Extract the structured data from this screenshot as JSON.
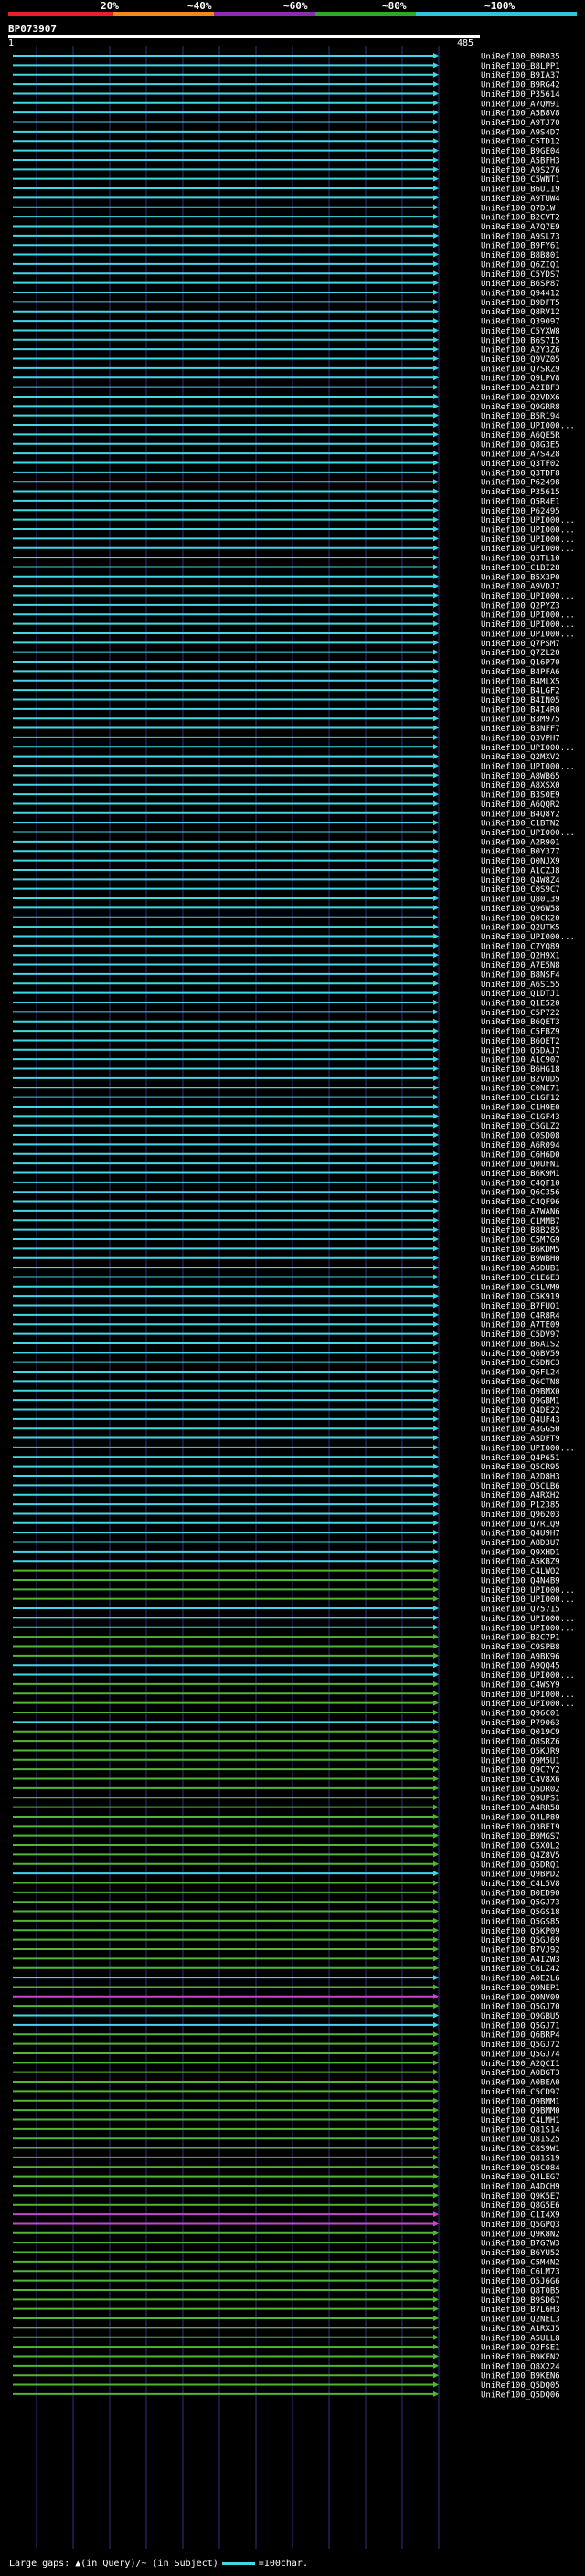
{
  "scale": {
    "labels": [
      "20%",
      "~40%",
      "~60%",
      "~80%",
      "~100%"
    ],
    "colors": [
      "#e8202a",
      "#f08a1a",
      "#8b2db3",
      "#2da82b",
      "#2dc7d8"
    ]
  },
  "query": {
    "name": "BP073907",
    "start": "1",
    "end": "485"
  },
  "colors": {
    "identity_high": "#3fd9e6",
    "identity_mid": "#4fb833",
    "identity_low": "#cc44cc",
    "grid": "#303080"
  },
  "legend": {
    "text": "Large gaps: ▲(in Query)/~ (in Subject)",
    "line_label": "=100char."
  },
  "hits": [
    {
      "label": "UniRef100_B9R035",
      "color": "cyan"
    },
    {
      "label": "UniRef100_B8LPP1",
      "color": "cyan"
    },
    {
      "label": "UniRef100_B9IA37",
      "color": "cyan"
    },
    {
      "label": "UniRef100_B9RG42",
      "color": "cyan"
    },
    {
      "label": "UniRef100_P35614",
      "color": "cyan"
    },
    {
      "label": "UniRef100_A7QM91",
      "color": "cyan"
    },
    {
      "label": "UniRef100_A5B8V8",
      "color": "cyan"
    },
    {
      "label": "UniRef100_A9TJ70",
      "color": "cyan"
    },
    {
      "label": "UniRef100_A9S4D7",
      "color": "cyan"
    },
    {
      "label": "UniRef100_C5TD12",
      "color": "cyan"
    },
    {
      "label": "UniRef100_B9GE04",
      "color": "cyan"
    },
    {
      "label": "UniRef100_A5BFH3",
      "color": "cyan"
    },
    {
      "label": "UniRef100_A9S276",
      "color": "cyan"
    },
    {
      "label": "UniRef100_C5WNT1",
      "color": "cyan"
    },
    {
      "label": "UniRef100_B6U119",
      "color": "cyan"
    },
    {
      "label": "UniRef100_A9TUW4",
      "color": "cyan"
    },
    {
      "label": "UniRef100_Q7D1W",
      "color": "cyan"
    },
    {
      "label": "UniRef100_B2CVT2",
      "color": "cyan"
    },
    {
      "label": "UniRef100_A7Q7E9",
      "color": "cyan"
    },
    {
      "label": "UniRef100_A9SL73",
      "color": "cyan"
    },
    {
      "label": "UniRef100_B9FY61",
      "color": "cyan"
    },
    {
      "label": "UniRef100_B8B801",
      "color": "cyan"
    },
    {
      "label": "UniRef100_Q6ZIQ1",
      "color": "cyan"
    },
    {
      "label": "UniRef100_C5YDS7",
      "color": "cyan"
    },
    {
      "label": "UniRef100_B6SP87",
      "color": "cyan"
    },
    {
      "label": "UniRef100_Q94412",
      "color": "cyan"
    },
    {
      "label": "UniRef100_B9DFT5",
      "color": "cyan"
    },
    {
      "label": "UniRef100_Q8RV12",
      "color": "cyan"
    },
    {
      "label": "UniRef100_Q39097",
      "color": "cyan"
    },
    {
      "label": "UniRef100_C5YXW8",
      "color": "cyan"
    },
    {
      "label": "UniRef100_B6S7I5",
      "color": "cyan"
    },
    {
      "label": "UniRef100_A2Y3Z6",
      "color": "cyan"
    },
    {
      "label": "UniRef100_Q9VZ05",
      "color": "cyan"
    },
    {
      "label": "UniRef100_Q7SRZ9",
      "color": "cyan"
    },
    {
      "label": "UniRef100_Q9LPV8",
      "color": "cyan"
    },
    {
      "label": "UniRef100_A2IBF3",
      "color": "cyan"
    },
    {
      "label": "UniRef100_Q2VDX6",
      "color": "cyan"
    },
    {
      "label": "UniRef100_Q9GRR8",
      "color": "cyan"
    },
    {
      "label": "UniRef100_B5R194",
      "color": "cyan"
    },
    {
      "label": "UniRef100_UPI000...",
      "color": "cyan"
    },
    {
      "label": "UniRef100_A6QE5R",
      "color": "cyan"
    },
    {
      "label": "UniRef100_Q8G3E5",
      "color": "cyan"
    },
    {
      "label": "UniRef100_A7S428",
      "color": "cyan"
    },
    {
      "label": "UniRef100_Q3TF02",
      "color": "cyan"
    },
    {
      "label": "UniRef100_Q3TDF8",
      "color": "cyan"
    },
    {
      "label": "UniRef100_P62498",
      "color": "cyan"
    },
    {
      "label": "UniRef100_P35615",
      "color": "cyan"
    },
    {
      "label": "UniRef100_Q5R4E1",
      "color": "cyan"
    },
    {
      "label": "UniRef100_P62495",
      "color": "cyan"
    },
    {
      "label": "UniRef100_UPI000...",
      "color": "cyan"
    },
    {
      "label": "UniRef100_UPI000...",
      "color": "cyan"
    },
    {
      "label": "UniRef100_UPI000...",
      "color": "cyan"
    },
    {
      "label": "UniRef100_UPI000...",
      "color": "cyan"
    },
    {
      "label": "UniRef100_Q3TL10",
      "color": "cyan"
    },
    {
      "label": "UniRef100_C1BI28",
      "color": "cyan"
    },
    {
      "label": "UniRef100_B5X3P0",
      "color": "cyan"
    },
    {
      "label": "UniRef100_A9VDJ7",
      "color": "cyan"
    },
    {
      "label": "UniRef100_UPI000...",
      "color": "cyan"
    },
    {
      "label": "UniRef100_Q2PYZ3",
      "color": "cyan"
    },
    {
      "label": "UniRef100_UPI000...",
      "color": "cyan"
    },
    {
      "label": "UniRef100_UPI000...",
      "color": "cyan"
    },
    {
      "label": "UniRef100_UPI000...",
      "color": "cyan"
    },
    {
      "label": "UniRef100_Q7PSM7",
      "color": "cyan"
    },
    {
      "label": "UniRef100_Q7ZL20",
      "color": "cyan"
    },
    {
      "label": "UniRef100_Q16P70",
      "color": "cyan"
    },
    {
      "label": "UniRef100_B4PFA6",
      "color": "cyan"
    },
    {
      "label": "UniRef100_B4MLX5",
      "color": "cyan"
    },
    {
      "label": "UniRef100_B4LGF2",
      "color": "cyan"
    },
    {
      "label": "UniRef100_B4IN05",
      "color": "cyan"
    },
    {
      "label": "UniRef100_B4I4R0",
      "color": "cyan"
    },
    {
      "label": "UniRef100_B3M975",
      "color": "cyan"
    },
    {
      "label": "UniRef100_B3NFF7",
      "color": "cyan"
    },
    {
      "label": "UniRef100_Q3VPH7",
      "color": "cyan"
    },
    {
      "label": "UniRef100_UPI000...",
      "color": "cyan"
    },
    {
      "label": "UniRef100_Q2MXV2",
      "color": "cyan"
    },
    {
      "label": "UniRef100_UPI000...",
      "color": "cyan"
    },
    {
      "label": "UniRef100_A8WB65",
      "color": "cyan"
    },
    {
      "label": "UniRef100_A8XSX0",
      "color": "cyan"
    },
    {
      "label": "UniRef100_B3S0E9",
      "color": "cyan"
    },
    {
      "label": "UniRef100_A6QQR2",
      "color": "cyan"
    },
    {
      "label": "UniRef100_B4Q8Y2",
      "color": "cyan"
    },
    {
      "label": "UniRef100_C1BTN2",
      "color": "cyan"
    },
    {
      "label": "UniRef100_UPI000...",
      "color": "cyan"
    },
    {
      "label": "UniRef100_A2R901",
      "color": "cyan"
    },
    {
      "label": "UniRef100_B0Y377",
      "color": "cyan"
    },
    {
      "label": "UniRef100_Q0NJX9",
      "color": "cyan"
    },
    {
      "label": "UniRef100_A1CZJ8",
      "color": "cyan"
    },
    {
      "label": "UniRef100_Q4W8Z4",
      "color": "cyan"
    },
    {
      "label": "UniRef100_C0S9C7",
      "color": "cyan"
    },
    {
      "label": "UniRef100_Q80139",
      "color": "cyan"
    },
    {
      "label": "UniRef100_Q96W58",
      "color": "cyan"
    },
    {
      "label": "UniRef100_Q0CK20",
      "color": "cyan"
    },
    {
      "label": "UniRef100_Q2UTK5",
      "color": "cyan"
    },
    {
      "label": "UniRef100_UPI000...",
      "color": "cyan"
    },
    {
      "label": "UniRef100_C7YQ89",
      "color": "cyan"
    },
    {
      "label": "UniRef100_Q2H9X1",
      "color": "cyan"
    },
    {
      "label": "UniRef100_A7E5N8",
      "color": "cyan"
    },
    {
      "label": "UniRef100_B8NSF4",
      "color": "cyan"
    },
    {
      "label": "UniRef100_A6S155",
      "color": "cyan"
    },
    {
      "label": "UniRef100_Q1DTJ1",
      "color": "cyan"
    },
    {
      "label": "UniRef100_Q1E520",
      "color": "cyan"
    },
    {
      "label": "UniRef100_C5P722",
      "color": "cyan"
    },
    {
      "label": "UniRef100_B6QET3",
      "color": "cyan"
    },
    {
      "label": "UniRef100_C5FBZ9",
      "color": "cyan"
    },
    {
      "label": "UniRef100_B6QET2",
      "color": "cyan"
    },
    {
      "label": "UniRef100_Q5DAJ7",
      "color": "cyan"
    },
    {
      "label": "UniRef100_A1C907",
      "color": "cyan"
    },
    {
      "label": "UniRef100_B6HG18",
      "color": "cyan"
    },
    {
      "label": "UniRef100_B2VUD5",
      "color": "cyan"
    },
    {
      "label": "UniRef100_C0NE71",
      "color": "cyan"
    },
    {
      "label": "UniRef100_C1GF12",
      "color": "cyan"
    },
    {
      "label": "UniRef100_C1H9E0",
      "color": "cyan"
    },
    {
      "label": "UniRef100_C1GF43",
      "color": "cyan"
    },
    {
      "label": "UniRef100_C5GLZ2",
      "color": "cyan"
    },
    {
      "label": "UniRef100_C0SD08",
      "color": "cyan"
    },
    {
      "label": "UniRef100_A6R094",
      "color": "cyan"
    },
    {
      "label": "UniRef100_C6H6D0",
      "color": "cyan"
    },
    {
      "label": "UniRef100_Q0UFN1",
      "color": "cyan"
    },
    {
      "label": "UniRef100_B6K9M1",
      "color": "cyan"
    },
    {
      "label": "UniRef100_C4QF10",
      "color": "cyan"
    },
    {
      "label": "UniRef100_Q6C356",
      "color": "cyan"
    },
    {
      "label": "UniRef100_C4QF96",
      "color": "cyan"
    },
    {
      "label": "UniRef100_A7WAN6",
      "color": "cyan"
    },
    {
      "label": "UniRef100_C1MMB7",
      "color": "cyan"
    },
    {
      "label": "UniRef100_B8B285",
      "color": "cyan"
    },
    {
      "label": "UniRef100_C5M7G9",
      "color": "cyan"
    },
    {
      "label": "UniRef100_B6KDM5",
      "color": "cyan"
    },
    {
      "label": "UniRef100_B9WBH0",
      "color": "cyan"
    },
    {
      "label": "UniRef100_A5DUB1",
      "color": "cyan"
    },
    {
      "label": "UniRef100_C1E6E3",
      "color": "cyan"
    },
    {
      "label": "UniRef100_C5LVM9",
      "color": "cyan"
    },
    {
      "label": "UniRef100_C5K919",
      "color": "cyan"
    },
    {
      "label": "UniRef100_B7FUO1",
      "color": "cyan"
    },
    {
      "label": "UniRef100_C4R8R4",
      "color": "cyan"
    },
    {
      "label": "UniRef100_A7TE09",
      "color": "cyan"
    },
    {
      "label": "UniRef100_C5DV97",
      "color": "cyan"
    },
    {
      "label": "UniRef100_B6AIS2",
      "color": "cyan"
    },
    {
      "label": "UniRef100_Q6BV59",
      "color": "cyan"
    },
    {
      "label": "UniRef100_C5DNC3",
      "color": "cyan"
    },
    {
      "label": "UniRef100_Q6FL24",
      "color": "cyan"
    },
    {
      "label": "UniRef100_Q6CTN8",
      "color": "cyan"
    },
    {
      "label": "UniRef100_Q9BMX0",
      "color": "cyan"
    },
    {
      "label": "UniRef100_Q9GBM1",
      "color": "cyan"
    },
    {
      "label": "UniRef100_Q4DE22",
      "color": "cyan"
    },
    {
      "label": "UniRef100_Q4UF43",
      "color": "cyan"
    },
    {
      "label": "UniRef100_A3GG50",
      "color": "cyan"
    },
    {
      "label": "UniRef100_A5DFT9",
      "color": "cyan"
    },
    {
      "label": "UniRef100_UPI000...",
      "color": "cyan"
    },
    {
      "label": "UniRef100_Q4P651",
      "color": "cyan"
    },
    {
      "label": "UniRef100_Q5CR95",
      "color": "cyan"
    },
    {
      "label": "UniRef100_A2D8H3",
      "color": "cyan"
    },
    {
      "label": "UniRef100_Q5CLB6",
      "color": "cyan"
    },
    {
      "label": "UniRef100_A4RXH2",
      "color": "cyan"
    },
    {
      "label": "UniRef100_P12385",
      "color": "cyan"
    },
    {
      "label": "UniRef100_Q96203",
      "color": "cyan"
    },
    {
      "label": "UniRef100_Q7R1Q9",
      "color": "cyan"
    },
    {
      "label": "UniRef100_Q4U9H7",
      "color": "cyan"
    },
    {
      "label": "UniRef100_A8D3U7",
      "color": "cyan"
    },
    {
      "label": "UniRef100_Q9XHD1",
      "color": "cyan"
    },
    {
      "label": "UniRef100_A5KBZ9",
      "color": "cyan"
    },
    {
      "label": "UniRef100_C4LWQ2",
      "color": "green"
    },
    {
      "label": "UniRef100_Q4N4B9",
      "color": "green"
    },
    {
      "label": "UniRef100_UPI000...",
      "color": "green"
    },
    {
      "label": "UniRef100_UPI000...",
      "color": "green"
    },
    {
      "label": "UniRef100_Q75715",
      "color": "cyan"
    },
    {
      "label": "UniRef100_UPI000...",
      "color": "cyan"
    },
    {
      "label": "UniRef100_UPI000...",
      "color": "cyan"
    },
    {
      "label": "UniRef100_B2C7P1",
      "color": "green"
    },
    {
      "label": "UniRef100_C9SPB8",
      "color": "green"
    },
    {
      "label": "UniRef100_A9BK96",
      "color": "green"
    },
    {
      "label": "UniRef100_A9QQ45",
      "color": "cyan"
    },
    {
      "label": "UniRef100_UPI000...",
      "color": "cyan"
    },
    {
      "label": "UniRef100_C4WSY9",
      "color": "green"
    },
    {
      "label": "UniRef100_UPI000...",
      "color": "green"
    },
    {
      "label": "UniRef100_UPI000...",
      "color": "green"
    },
    {
      "label": "UniRef100_Q96C01",
      "color": "green"
    },
    {
      "label": "UniRef100_P79063",
      "color": "cyan"
    },
    {
      "label": "UniRef100_Q019C9",
      "color": "green"
    },
    {
      "label": "UniRef100_Q8SRZ6",
      "color": "green"
    },
    {
      "label": "UniRef100_Q5KJR9",
      "color": "green"
    },
    {
      "label": "UniRef100_Q9M5U1",
      "color": "green"
    },
    {
      "label": "UniRef100_Q9C7Y2",
      "color": "green"
    },
    {
      "label": "UniRef100_C4V8X6",
      "color": "green"
    },
    {
      "label": "UniRef100_Q5DR02",
      "color": "green"
    },
    {
      "label": "UniRef100_Q9UPS1",
      "color": "green"
    },
    {
      "label": "UniRef100_A4RR58",
      "color": "green"
    },
    {
      "label": "UniRef100_Q4LP89",
      "color": "green"
    },
    {
      "label": "UniRef100_Q3BEI9",
      "color": "green"
    },
    {
      "label": "UniRef100_B9MGS7",
      "color": "green"
    },
    {
      "label": "UniRef100_C5X0L2",
      "color": "green"
    },
    {
      "label": "UniRef100_Q4Z8V5",
      "color": "green"
    },
    {
      "label": "UniRef100_Q5DRQ1",
      "color": "green"
    },
    {
      "label": "UniRef100_Q9BPD2",
      "color": "cyan"
    },
    {
      "label": "UniRef100_C4L5V8",
      "color": "green"
    },
    {
      "label": "UniRef100_B0ED90",
      "color": "green"
    },
    {
      "label": "UniRef100_Q5GJ73",
      "color": "green"
    },
    {
      "label": "UniRef100_Q5GS18",
      "color": "green"
    },
    {
      "label": "UniRef100_Q5GS85",
      "color": "green"
    },
    {
      "label": "UniRef100_Q5KP09",
      "color": "green"
    },
    {
      "label": "UniRef100_Q5GJ69",
      "color": "green"
    },
    {
      "label": "UniRef100_B7VJ92",
      "color": "green"
    },
    {
      "label": "UniRef100_A4IZW3",
      "color": "green"
    },
    {
      "label": "UniRef100_C6LZ42",
      "color": "green"
    },
    {
      "label": "UniRef100_A0E2L6",
      "color": "cyan"
    },
    {
      "label": "UniRef100_Q9NEP1",
      "color": "green"
    },
    {
      "label": "UniRef100_Q9NV09",
      "color": "magenta"
    },
    {
      "label": "UniRef100_Q5GJ70",
      "color": "green"
    },
    {
      "label": "UniRef100_Q9GBU5",
      "color": "cyan"
    },
    {
      "label": "UniRef100_Q5GJ71",
      "color": "cyan"
    },
    {
      "label": "UniRef100_Q6BRP4",
      "color": "green"
    },
    {
      "label": "UniRef100_Q5GJ72",
      "color": "green"
    },
    {
      "label": "UniRef100_Q5GJ74",
      "color": "green"
    },
    {
      "label": "UniRef100_A2QCI1",
      "color": "green"
    },
    {
      "label": "UniRef100_A0BGT3",
      "color": "green"
    },
    {
      "label": "UniRef100_A0BEA0",
      "color": "green"
    },
    {
      "label": "UniRef100_C5CD97",
      "color": "green"
    },
    {
      "label": "UniRef100_Q9BMM1",
      "color": "green"
    },
    {
      "label": "UniRef100_Q9BMM0",
      "color": "green"
    },
    {
      "label": "UniRef100_C4LMH1",
      "color": "green"
    },
    {
      "label": "UniRef100_Q81S14",
      "color": "green"
    },
    {
      "label": "UniRef100_Q81S25",
      "color": "green"
    },
    {
      "label": "UniRef100_C8S9W1",
      "color": "green"
    },
    {
      "label": "UniRef100_Q81S19",
      "color": "green"
    },
    {
      "label": "UniRef100_Q5C084",
      "color": "green"
    },
    {
      "label": "UniRef100_Q4LEG7",
      "color": "green"
    },
    {
      "label": "UniRef100_A4DCH9",
      "color": "green"
    },
    {
      "label": "UniRef100_Q9K5E7",
      "color": "green"
    },
    {
      "label": "UniRef100_Q8G5E6",
      "color": "green"
    },
    {
      "label": "UniRef100_C1I4X9",
      "color": "magenta"
    },
    {
      "label": "UniRef100_Q5GPQ3",
      "color": "magenta"
    },
    {
      "label": "UniRef100_Q9K8N2",
      "color": "green"
    },
    {
      "label": "UniRef100_B7G7W3",
      "color": "green"
    },
    {
      "label": "UniRef100_B6YU52",
      "color": "green"
    },
    {
      "label": "UniRef100_C5M4N2",
      "color": "green"
    },
    {
      "label": "UniRef100_C6LM73",
      "color": "green"
    },
    {
      "label": "UniRef100_Q5J6G6",
      "color": "green"
    },
    {
      "label": "UniRef100_Q8T0B5",
      "color": "green"
    },
    {
      "label": "UniRef100_B9SD67",
      "color": "green"
    },
    {
      "label": "UniRef100_B7L6H3",
      "color": "green"
    },
    {
      "label": "UniRef100_Q2NEL3",
      "color": "green"
    },
    {
      "label": "UniRef100_A1RXJ5",
      "color": "green"
    },
    {
      "label": "UniRef100_A5ULL8",
      "color": "green"
    },
    {
      "label": "UniRef100_Q2FSE1",
      "color": "green"
    },
    {
      "label": "UniRef100_B9KEN2",
      "color": "green"
    },
    {
      "label": "UniRef100_Q8X224",
      "color": "green"
    },
    {
      "label": "UniRef100_B9KEN6",
      "color": "green"
    },
    {
      "label": "UniRef100_Q5DQ05",
      "color": "green"
    },
    {
      "label": "UniRef100_Q5DQ06",
      "color": "green"
    }
  ]
}
